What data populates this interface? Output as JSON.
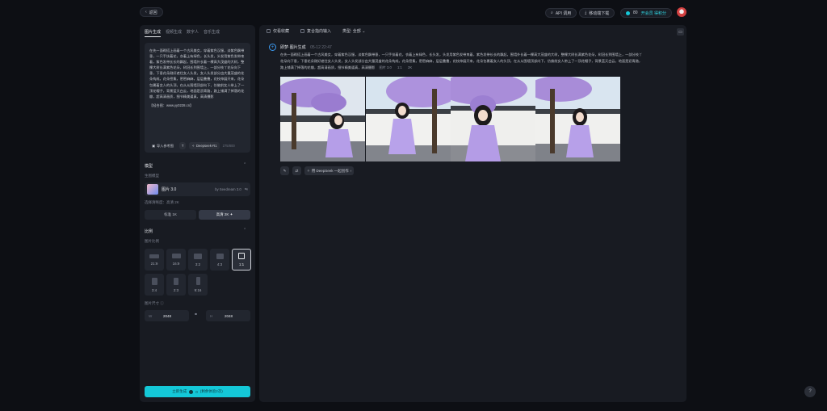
{
  "header": {
    "back_label": "返回",
    "api_label": "API 调用",
    "download_label": "移动端下载",
    "points": "80",
    "upgrade_label": "开会员 得积分"
  },
  "sidebar": {
    "tabs": [
      "图片生成",
      "视频生成",
      "数字人",
      "音乐生成"
    ],
    "prompt_text": "在先一面砌搭上画着一个古风美女，穿着紫色汉服，淡紫色飘带垂，一只手扶着花，衣着上有绿色，长头发，头发用紫色发带束着，紫色发带长长的飘起，围墙外长着一棵高大茂盛的大树，整棵大树长满紫色花朵，树冠长到围墙上，一部分枝丫花朵向下垂，下垂花朵刚好遮住女人头发，女人头发部分由大量茂盛的花朵构成，花朵密集，密密麻麻，层层叠叠，花枝伸展开来，花朵包裹着女人的头顶，在从从围墙顶部向下，仿佛前女人带上了一顶花帽子，背景蓝天白云，地面是沥青路，路上铺满了掉落的花瓣，超高清画质，细节精美逼真，高清摄影",
    "prompt_extra": "【轻合图：www.yy0228.cn】",
    "import_label": "导入参考图",
    "deepseek_label": "Deepseek-R1",
    "char_count": "275/800",
    "model_section": "模型",
    "model_sublabel": "生图模型",
    "model_name": "图片 3.0",
    "model_by": "by Seedream 3.0",
    "quality_sublabel": "选择清晰度：高清 2K",
    "quality_options": [
      "标准 1K",
      "高清 2K ✦"
    ],
    "ratio_section": "比例",
    "ratio_sublabel": "图片比例",
    "ratios": [
      "21:9",
      "16:9",
      "3:2",
      "4:3",
      "1:1",
      "3:4",
      "2:3",
      "9:16"
    ],
    "size_sublabel": "图片尺寸",
    "width_prefix": "W",
    "width_value": "2048",
    "height_prefix": "H",
    "height_value": "2048",
    "generate_label": "立即生成",
    "generate_cost": "0",
    "generate_note": "(剩余体验2次)"
  },
  "main": {
    "filter_fav": "仅看收藏",
    "filter_input": "复合指向输入",
    "filter_type": "类型: 全部",
    "msg_title": "即梦·图片生成",
    "msg_time": "05-12  22:47",
    "msg_text": "在先一面砌搭上画着一个古风美女，穿着紫色汉服，淡紫色飘带垂，一只手扶着花，衣着上有绿色，长头发，头发用紫色发带束着，紫色发带长长的飘起，围墙外长着一棵高大茂盛的大树，整棵大树长满紫色花朵，树冠长到围墙上，一部分枝丫花朵向下垂，下垂花朵刚好遮住女人头发，女人头发部分由大量茂盛的花朵构成，花朵密集，密密麻麻，层层叠叠，花枝伸展开来，花朵包裹着女人的头顶，在从从围墙顶部向下，仿佛前女人带上了一顶花帽子，背景蓝天白云，地面是沥青路，路上铺满了掉落的花瓣，超高清画质，细节精美逼真，高清摄影",
    "msg_meta": [
      "图片 3.0",
      "1:1",
      "2K"
    ],
    "deepseek_action": "用 DeepSeek 一起创作"
  },
  "help_label": "?"
}
